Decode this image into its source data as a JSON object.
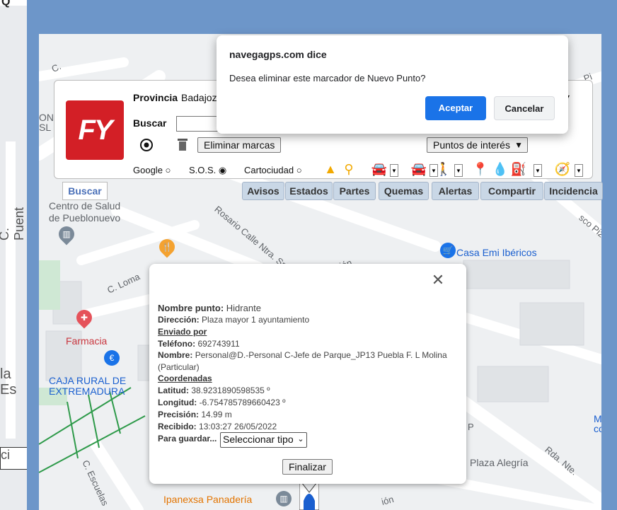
{
  "dialog": {
    "title": "navegagps.com dice",
    "message": "Desea eliminar este marcador de Nuevo Punto?",
    "accept_label": "Aceptar",
    "cancel_label": "Cancelar",
    "accent": "#1a73e8"
  },
  "panel": {
    "logo_text": "FY",
    "provincia_label": "Provincia",
    "provincia_value": "Badajoz",
    "buscar_label": "Buscar",
    "eliminar_label": "Eliminar marcas",
    "puntos_label": "Puntos de interés",
    "radios": [
      {
        "label": "Google",
        "checked": false
      },
      {
        "label": "S.O.S.",
        "checked": true
      },
      {
        "label": "Cartociudad",
        "checked": false
      }
    ]
  },
  "side_buscar": "Buscar",
  "tabs": [
    "Avisos",
    "Estados",
    "Partes",
    "Quemas",
    "Alertas",
    "Compartir",
    "Incidencia"
  ],
  "map": {
    "labels": {
      "centro": "Centro de Salud",
      "pueblonuevo": "de Pueblonuevo",
      "farmacia": "Farmacia",
      "caja1": "CAJA RURAL DE",
      "caja2": "EXTREMADURA",
      "casa_emi": "Casa Emi Ibéricos",
      "plaza_alegria": "Plaza Alegría",
      "ipanexsa": "Ipanexsa Panadería",
      "loma": "C. Loma",
      "rosario": "Rosario Calle Ntra. Sr",
      "c_puente": "C. Puent",
      "escuelas": "C. Escuelas",
      "rda_nte": "Rda. Nte.",
      "c_left": "C.",
      "pizarro": "sco Piz",
      "on": "ON",
      "sl": "SL",
      "la": "la",
      "es": "Es",
      "ci": "ci",
      "m": "M",
      "co": "co",
      "ion": "ión",
      "ion2": "ión",
      "p": "P",
      "pi": "Pi",
      "c_top": "C."
    }
  },
  "info": {
    "nombre_punto_label": "Nombre punto:",
    "nombre_punto": "Hidrante",
    "direccion_label": "Dirección:",
    "direccion": "Plaza mayor 1 ayuntamiento",
    "enviado_por": "Enviado por",
    "telefono_label": "Teléfono:",
    "telefono": "692743911",
    "nombre_label": "Nombre:",
    "nombre": "Personal@D.-Personal C-Jefe de Parque_JP13 Puebla F. L Molina",
    "particular": "(Particular)",
    "coordenadas": "Coordenadas",
    "latitud_label": "Latitud:",
    "latitud": "38.9231890598535 º",
    "longitud_label": "Longitud:",
    "longitud": "-6.754785789660423 º",
    "precision_label": "Precisión:",
    "precision": "14.99 m",
    "recibido_label": "Recibido:",
    "recibido": "13:03:27 26/05/2022",
    "guardar_label": "Para guardar...",
    "select_value": "Seleccionar tipo",
    "finalizar_label": "Finalizar"
  }
}
